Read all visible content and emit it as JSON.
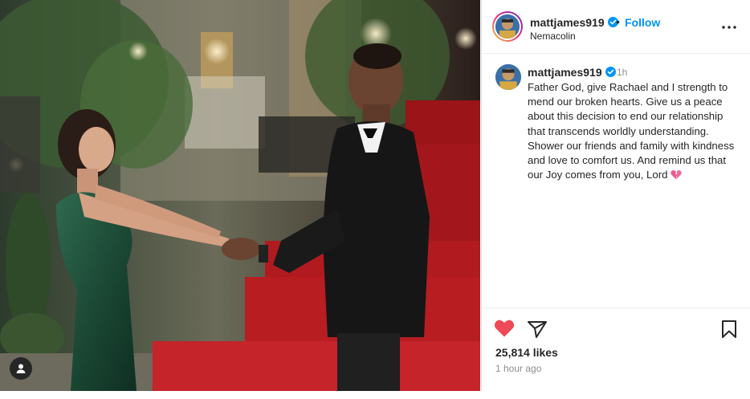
{
  "post": {
    "photo_alt": "",
    "header": {
      "username": "mattjames919",
      "separator": "•",
      "follow_label": "Follow",
      "location": "Nemacolin"
    },
    "caption": {
      "username": "mattjames919",
      "time": "1h",
      "text": "Father God, give Rachael and I strength to mend our broken hearts. Give us a peace about this decision to end our relationship that transcends worldly understanding. Shower our friends and family with kindness and love to comfort us. And remind us that our Joy comes from you, Lord",
      "emoji": "broken-heart"
    },
    "likes": "25,814 likes",
    "timestamp": "1 hour ago"
  },
  "colors": {
    "accent": "#0095f6",
    "like_red": "#ed4956",
    "text": "#262626",
    "secondary_text": "#8e8e8e"
  },
  "icons": {
    "verified": "verified-badge-icon",
    "more": "more-options-icon",
    "like": "heart-filled-icon",
    "share": "paper-plane-icon",
    "save": "bookmark-icon",
    "tagged_user": "user-tag-icon"
  }
}
